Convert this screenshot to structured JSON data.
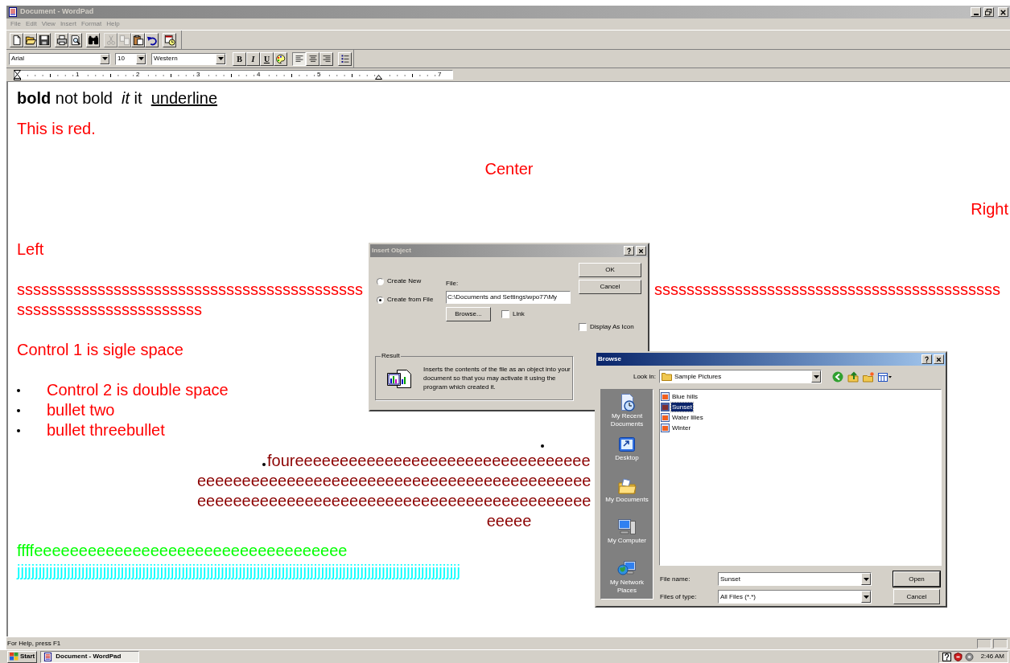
{
  "window": {
    "title": "Document - WordPad"
  },
  "menu": [
    "File",
    "Edit",
    "View",
    "Insert",
    "Format",
    "Help"
  ],
  "toolbar": [
    [
      {
        "kind": "new",
        "disabled": false
      },
      {
        "kind": "open",
        "disabled": false
      },
      {
        "kind": "save",
        "disabled": false
      }
    ],
    [
      {
        "kind": "print",
        "disabled": false
      },
      {
        "kind": "preview",
        "disabled": false
      }
    ],
    [
      {
        "kind": "find",
        "disabled": false
      }
    ],
    [
      {
        "kind": "cut",
        "disabled": true
      },
      {
        "kind": "copy",
        "disabled": true
      },
      {
        "kind": "paste",
        "disabled": false
      },
      {
        "kind": "undo",
        "disabled": false
      }
    ],
    [
      {
        "kind": "datetime",
        "disabled": false
      }
    ]
  ],
  "format_bar": {
    "font": "Arial",
    "size": "10",
    "script": "Western",
    "style_buttons": [
      {
        "kind": "bold",
        "label": "B"
      },
      {
        "kind": "italic",
        "label": "I"
      },
      {
        "kind": "underline",
        "label": "U"
      },
      {
        "kind": "color"
      }
    ],
    "align_buttons": [
      {
        "kind": "left",
        "selected": true
      },
      {
        "kind": "center",
        "selected": false
      },
      {
        "kind": "right",
        "selected": false
      }
    ],
    "bullets": {
      "selected": false
    }
  },
  "ruler": {
    "labels": [
      "1",
      "2",
      "3",
      "4",
      "5",
      "7"
    ]
  },
  "document": {
    "paragraphs": [
      {
        "kind": "runs",
        "color": "#000000",
        "runs": [
          {
            "text": "bold",
            "kind": "bold"
          },
          {
            "text": " not bold  ",
            "kind": "plain"
          },
          {
            "text": "it",
            "kind": "italic"
          },
          {
            "text": " it  ",
            "kind": "plain"
          },
          {
            "text": "underline",
            "kind": "underline"
          }
        ]
      },
      {
        "kind": "text",
        "color": "#ff0000",
        "text": "This is red."
      },
      {
        "kind": "centered",
        "color": "#ff0000",
        "text": "Center"
      },
      {
        "kind": "right",
        "color": "#ff0000",
        "text": "Right"
      },
      {
        "kind": "text",
        "color": "#ff0000",
        "text": "Left"
      },
      {
        "kind": "split",
        "color": "#ff0000",
        "text": "sssssssssssssssssssssssssssssssssssssssssss",
        "text_after": "sssssssssssssssssssssssssssssssssssssssssss"
      },
      {
        "kind": "text",
        "color": "#ff0000",
        "text": "sssssssssssssssssssssss"
      },
      {
        "kind": "text",
        "color": "#ff0000",
        "text": "Control 1 is sigle space"
      },
      {
        "kind": "bullet",
        "color": "#ff0000",
        "text": "Control 2 is double space"
      },
      {
        "kind": "bullet",
        "color": "#ff0000",
        "text": "bullet two"
      },
      {
        "kind": "bullet",
        "color": "#ff0000",
        "text": "bullet threebullet"
      },
      {
        "kind": "mark"
      },
      {
        "kind": "lead",
        "color": "#8b0000",
        "text": "foureeeeeeeeeeeeeeeeeeeeeeeeeeeeeeeee"
      },
      {
        "kind": "text",
        "color": "#8b0000",
        "text": "eeeeeeeeeeeeeeeeeeeeeeeeeeeeeeeeeeeeeeeeeeee"
      },
      {
        "kind": "text",
        "color": "#8b0000",
        "text": "eeeeeeeeeeeeeeeeeeeeeeeeeeeeeeeeeeeeeeeeeeee"
      },
      {
        "kind": "centered",
        "color": "#8b0000",
        "text": "eeeee"
      },
      {
        "kind": "text",
        "color": "#00ff00",
        "text": "ffffeeeeeeeeeeeeeeeeeeeeeeeeeeeeeeeeeee"
      },
      {
        "kind": "text",
        "color": "#00ffff",
        "text": "jjjjjjjjjjjjjjjjjjjjjjjjjjjjjjjjjjjjjjjjjjjjjjjjjjjjjjjjjjjjjjjjjjjjjjjjjjjjjjjjjjjjjjjjjjjjjjjjjjjjjjjjjjjjjjjjjjjjjjjjjjjj"
      }
    ]
  },
  "insert_object": {
    "title": "Insert Object",
    "options": [
      {
        "label": "Create New",
        "selected": false
      },
      {
        "label": "Create from File",
        "selected": true
      }
    ],
    "file_label": "File:",
    "file_value": "C:\\Documents and Settings\\wpo77\\My",
    "browse_button": "Browse...",
    "link": {
      "label": "Link",
      "checked": false
    },
    "buttons": [
      "OK",
      "Cancel"
    ],
    "display_as_icon": {
      "label": "Display As Icon",
      "checked": false
    },
    "result": {
      "label": "Result",
      "text": "Inserts the contents of the file as an object into your document so that you may activate it using the program which created it."
    }
  },
  "browse": {
    "title": "Browse",
    "look_in_label": "Look in:",
    "look_in": "Sample Pictures",
    "places": [
      {
        "kind": "recent",
        "label": "My Recent Documents"
      },
      {
        "kind": "desktop",
        "label": "Desktop"
      },
      {
        "kind": "documents",
        "label": "My Documents"
      },
      {
        "kind": "computer",
        "label": "My Computer"
      },
      {
        "kind": "network",
        "label": "My Network Places"
      }
    ],
    "files": [
      {
        "name": "Blue hills",
        "selected": false
      },
      {
        "name": "Sunset",
        "selected": true
      },
      {
        "name": "Water lilies",
        "selected": false
      },
      {
        "name": "Winter",
        "selected": false
      }
    ],
    "file_name_label": "File name:",
    "file_name": "Sunset",
    "file_type_label": "Files of type:",
    "file_type": "All Files (*.*)",
    "buttons": [
      "Open",
      "Cancel"
    ]
  },
  "status_bar": {
    "text": "For Help, press F1"
  },
  "taskbar": {
    "start": "Start",
    "tasks": [
      {
        "label": "Document - WordPad",
        "selected": true
      }
    ],
    "clock": "2:46 AM"
  }
}
